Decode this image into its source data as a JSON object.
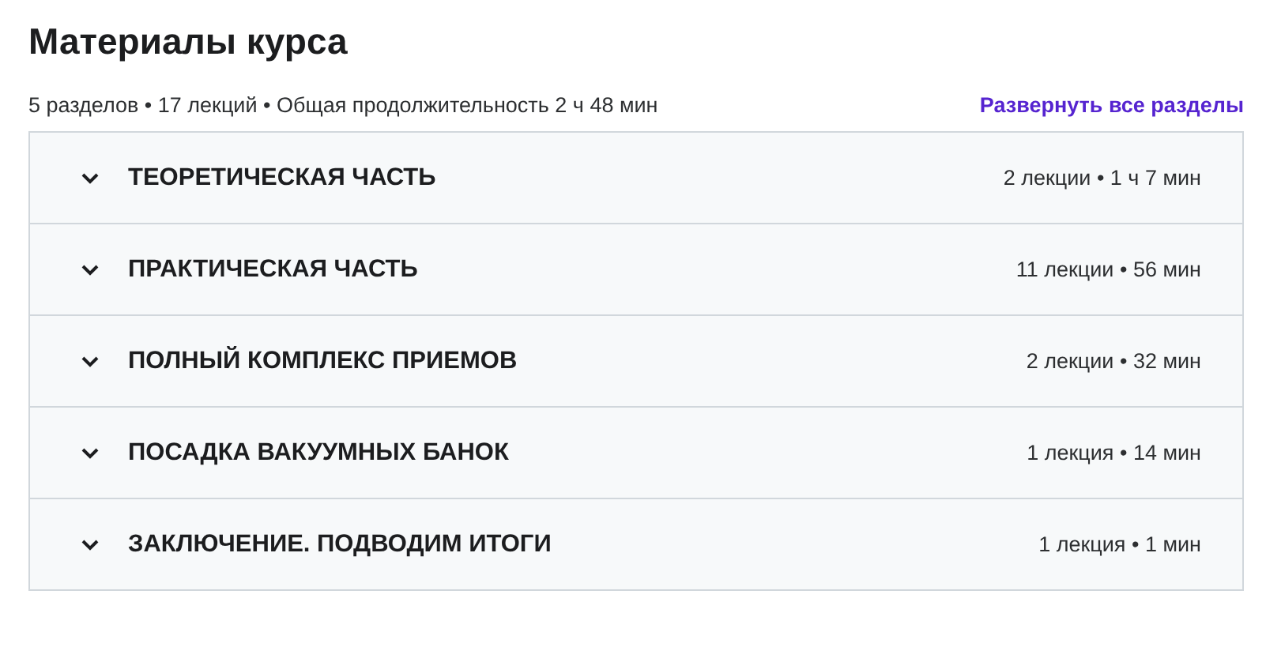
{
  "title": "Материалы курса",
  "summary": "5 разделов • 17 лекций • Общая продолжительность 2 ч 48 мин",
  "expand_all_link": "Развернуть все разделы",
  "sections": [
    {
      "title": "ТЕОРЕТИЧЕСКАЯ ЧАСТЬ",
      "meta": "2 лекции • 1 ч 7 мин",
      "expanded": false
    },
    {
      "title": "ПРАКТИЧЕСКАЯ ЧАСТЬ",
      "meta": "11 лекции • 56 мин",
      "expanded": false
    },
    {
      "title": "ПОЛНЫЙ КОМПЛЕКС ПРИЕМОВ",
      "meta": "2 лекции • 32 мин",
      "expanded": false
    },
    {
      "title": "ПОСАДКА ВАКУУМНЫХ БАНОК",
      "meta": "1 лекция • 14 мин",
      "expanded": false
    },
    {
      "title": "ЗАКЛЮЧЕНИЕ. ПОДВОДИМ ИТОГИ",
      "meta": "1 лекция • 1 мин",
      "expanded": false
    }
  ]
}
